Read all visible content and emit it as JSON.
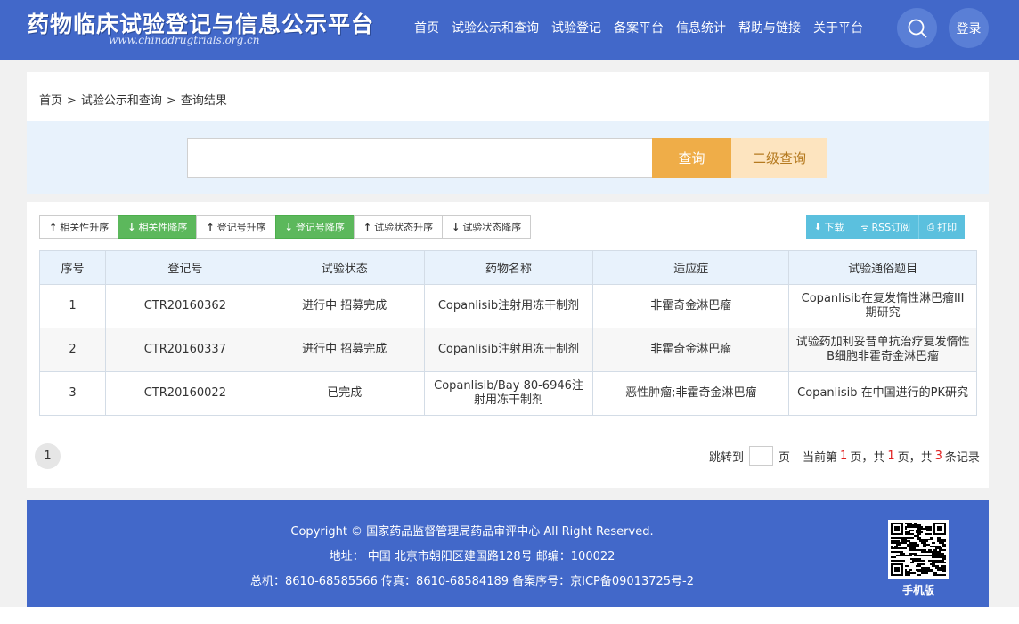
{
  "header": {
    "title": "药物临床试验登记与信息公示平台",
    "url": "www.chinadrugtrials.org.cn",
    "nav": [
      "首页",
      "试验公示和查询",
      "试验登记",
      "备案平台",
      "信息统计",
      "帮助与链接",
      "关于平台"
    ],
    "search_icon": "search-icon",
    "login_label": "登录"
  },
  "breadcrumb": [
    "首页",
    "试验公示和查询",
    "查询结果"
  ],
  "search": {
    "value": "",
    "query_label": "查询",
    "secondary_label": "二级查询"
  },
  "sort_buttons": [
    {
      "label": "相关性升序",
      "dir": "up",
      "active": false
    },
    {
      "label": "相关性降序",
      "dir": "down",
      "active": true
    },
    {
      "label": "登记号升序",
      "dir": "up",
      "active": false
    },
    {
      "label": "登记号降序",
      "dir": "down",
      "active": true
    },
    {
      "label": "试验状态升序",
      "dir": "up",
      "active": false
    },
    {
      "label": "试验状态降序",
      "dir": "down",
      "active": false
    }
  ],
  "actions": [
    {
      "label": "下载",
      "icon": "download-icon"
    },
    {
      "label": "RSS订阅",
      "icon": "rss-icon"
    },
    {
      "label": "打印",
      "icon": "print-icon"
    }
  ],
  "table": {
    "headers": [
      "序号",
      "登记号",
      "试验状态",
      "药物名称",
      "适应症",
      "试验通俗题目"
    ],
    "rows": [
      [
        "1",
        "CTR20160362",
        "进行中 招募完成",
        "Copanlisib注射用冻干制剂",
        "非霍奇金淋巴瘤",
        "Copanlisib在复发惰性淋巴瘤III 期研究"
      ],
      [
        "2",
        "CTR20160337",
        "进行中 招募完成",
        "Copanlisib注射用冻干制剂",
        "非霍奇金淋巴瘤",
        "试验药加利妥昔单抗治疗复发惰性B细胞非霍奇金淋巴瘤"
      ],
      [
        "3",
        "CTR20160022",
        "已完成",
        "Copanlisib/Bay 80-6946注射用冻干制剂",
        "恶性肿瘤;非霍奇金淋巴瘤",
        "Copanlisib 在中国进行的PK研究"
      ]
    ]
  },
  "pagination": {
    "page": "1",
    "jump_label": "跳转到",
    "page_unit": "页",
    "current_prefix": "当前第",
    "current": "1",
    "total_prefix": "页，共",
    "total_pages": "1",
    "records_prefix": "页，共",
    "total_records": "3",
    "records_suffix": "条记录"
  },
  "footer": {
    "copyright": "Copyright © 国家药品监督管理局药品审评中心 All Right Reserved.",
    "address": "地址： 中国 北京市朝阳区建国路128号 邮编：100022",
    "contact": "总机：8610-68585566 传真：8610-68584189 备案序号：京ICP备09013725号-2",
    "mobile_label": "手机版"
  }
}
